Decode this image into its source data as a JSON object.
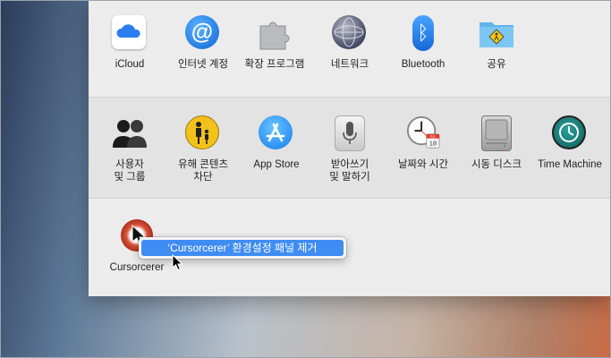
{
  "row1": [
    {
      "label": "iCloud",
      "icon": "icloud-icon"
    },
    {
      "label": "인터넷 계정",
      "icon": "internet-accounts-icon"
    },
    {
      "label": "확장 프로그램",
      "icon": "extensions-icon"
    },
    {
      "label": "네트워크",
      "icon": "network-icon"
    },
    {
      "label": "Bluetooth",
      "icon": "bluetooth-icon"
    },
    {
      "label": "공유",
      "icon": "sharing-icon"
    }
  ],
  "row2": [
    {
      "label": "사용자\n및 그룹",
      "icon": "users-groups-icon"
    },
    {
      "label": "유해 콘텐츠\n차단",
      "icon": "parental-controls-icon"
    },
    {
      "label": "App Store",
      "icon": "app-store-icon"
    },
    {
      "label": "받아쓰기\n및 말하기",
      "icon": "dictation-icon"
    },
    {
      "label": "날짜와 시간",
      "icon": "date-time-icon"
    },
    {
      "label": "시동 디스크",
      "icon": "startup-disk-icon"
    },
    {
      "label": "Time Machine",
      "icon": "time-machine-icon"
    }
  ],
  "row3": [
    {
      "label": "Cursorcerer",
      "icon": "cursorcerer-icon"
    }
  ],
  "context_menu": {
    "item": "‘Cursorcerer’ 환경설정 패널 제거"
  },
  "calendar": {
    "month": "JUL",
    "day": "18"
  },
  "colors": {
    "accent": "#3f8cf3",
    "window_bg": "#ececec"
  }
}
